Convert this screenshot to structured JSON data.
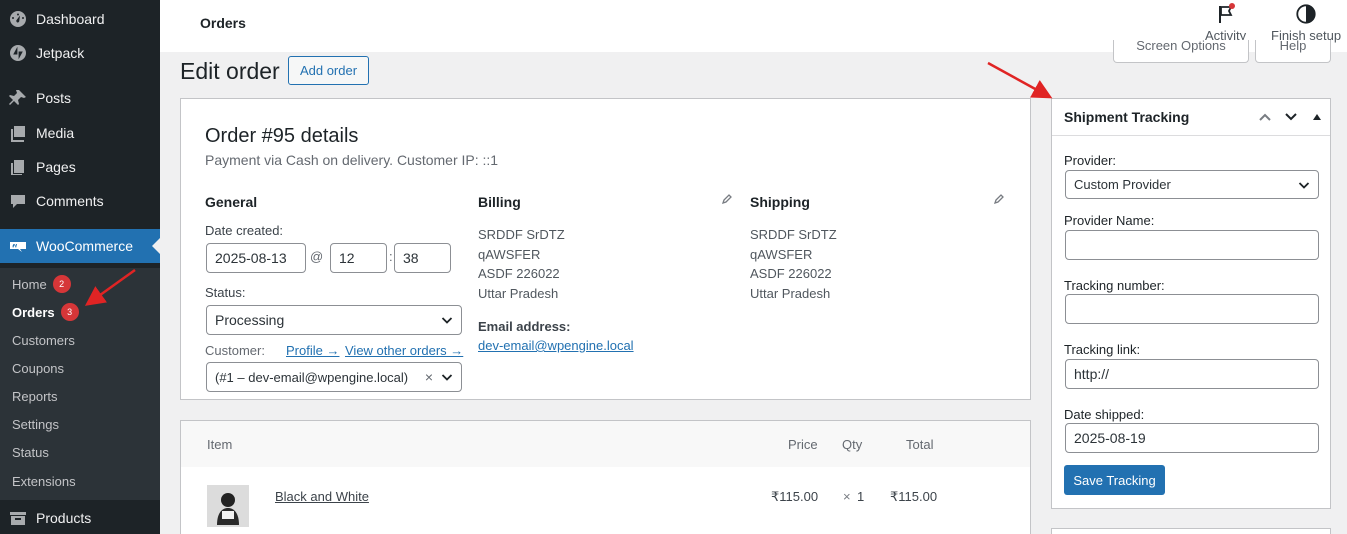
{
  "sidebar": {
    "items": [
      {
        "label": "Dashboard",
        "icon": "dashboard-icon"
      },
      {
        "label": "Jetpack",
        "icon": "jetpack-icon"
      },
      {
        "label": "Posts",
        "icon": "pin-icon"
      },
      {
        "label": "Media",
        "icon": "media-icon"
      },
      {
        "label": "Pages",
        "icon": "pages-icon"
      },
      {
        "label": "Comments",
        "icon": "comment-icon"
      },
      {
        "label": "WooCommerce",
        "icon": "woo-icon"
      },
      {
        "label": "Products",
        "icon": "archive-icon"
      }
    ],
    "submenu": [
      {
        "label": "Home",
        "count": "2"
      },
      {
        "label": "Orders",
        "count": "3"
      },
      {
        "label": "Customers"
      },
      {
        "label": "Coupons"
      },
      {
        "label": "Reports"
      },
      {
        "label": "Settings"
      },
      {
        "label": "Status"
      },
      {
        "label": "Extensions"
      }
    ]
  },
  "header": {
    "page_name": "Orders",
    "activity_label": "Activity",
    "finish_setup_label": "Finish setup",
    "screen_options_label": "Screen Options",
    "help_label": "Help"
  },
  "page": {
    "title": "Edit order",
    "add_order_label": "Add order"
  },
  "order": {
    "heading": "Order #95 details",
    "subheading": "Payment via Cash on delivery. Customer IP: ::1",
    "general": {
      "heading": "General",
      "date_created_label": "Date created:",
      "date_value": "2025-08-13",
      "at_sign": "@",
      "hour": "12",
      "colon": ":",
      "minute": "38",
      "status_label": "Status:",
      "status_value": "Processing",
      "customer_label": "Customer:",
      "profile_link": "Profile →",
      "view_other_orders_link": "View other orders →",
      "customer_value": "(#1 – dev-email@wpengine.local)",
      "clear_glyph": "×"
    },
    "billing": {
      "heading": "Billing",
      "lines": [
        "SRDDF SrDTZ",
        "qAWSFER",
        "ASDF 226022",
        "Uttar Pradesh"
      ],
      "email_label": "Email address:",
      "email_value": "dev-email@wpengine.local"
    },
    "shipping": {
      "heading": "Shipping",
      "lines": [
        "SRDDF SrDTZ",
        "qAWSFER",
        "ASDF 226022",
        "Uttar Pradesh"
      ]
    }
  },
  "items_table": {
    "headers": {
      "item": "Item",
      "price": "Price",
      "qty": "Qty",
      "total": "Total"
    },
    "rows": [
      {
        "name": "Black and White",
        "price": "₹115.00",
        "qty_sign": "×",
        "qty": "1",
        "total": "₹115.00"
      }
    ]
  },
  "shipment_tracking": {
    "title": "Shipment Tracking",
    "provider_label": "Provider:",
    "provider_value": "Custom Provider",
    "provider_name_label": "Provider Name:",
    "provider_name_value": "",
    "tracking_number_label": "Tracking number:",
    "tracking_number_value": "",
    "tracking_link_label": "Tracking link:",
    "tracking_link_value": "http://",
    "date_shipped_label": "Date shipped:",
    "date_shipped_value": "2025-08-19",
    "save_label": "Save Tracking"
  },
  "colors": {
    "accent": "#2271b1",
    "sidebar_bg": "#1d2327",
    "badge": "#d63638",
    "annotation_arrow": "#e02424"
  }
}
